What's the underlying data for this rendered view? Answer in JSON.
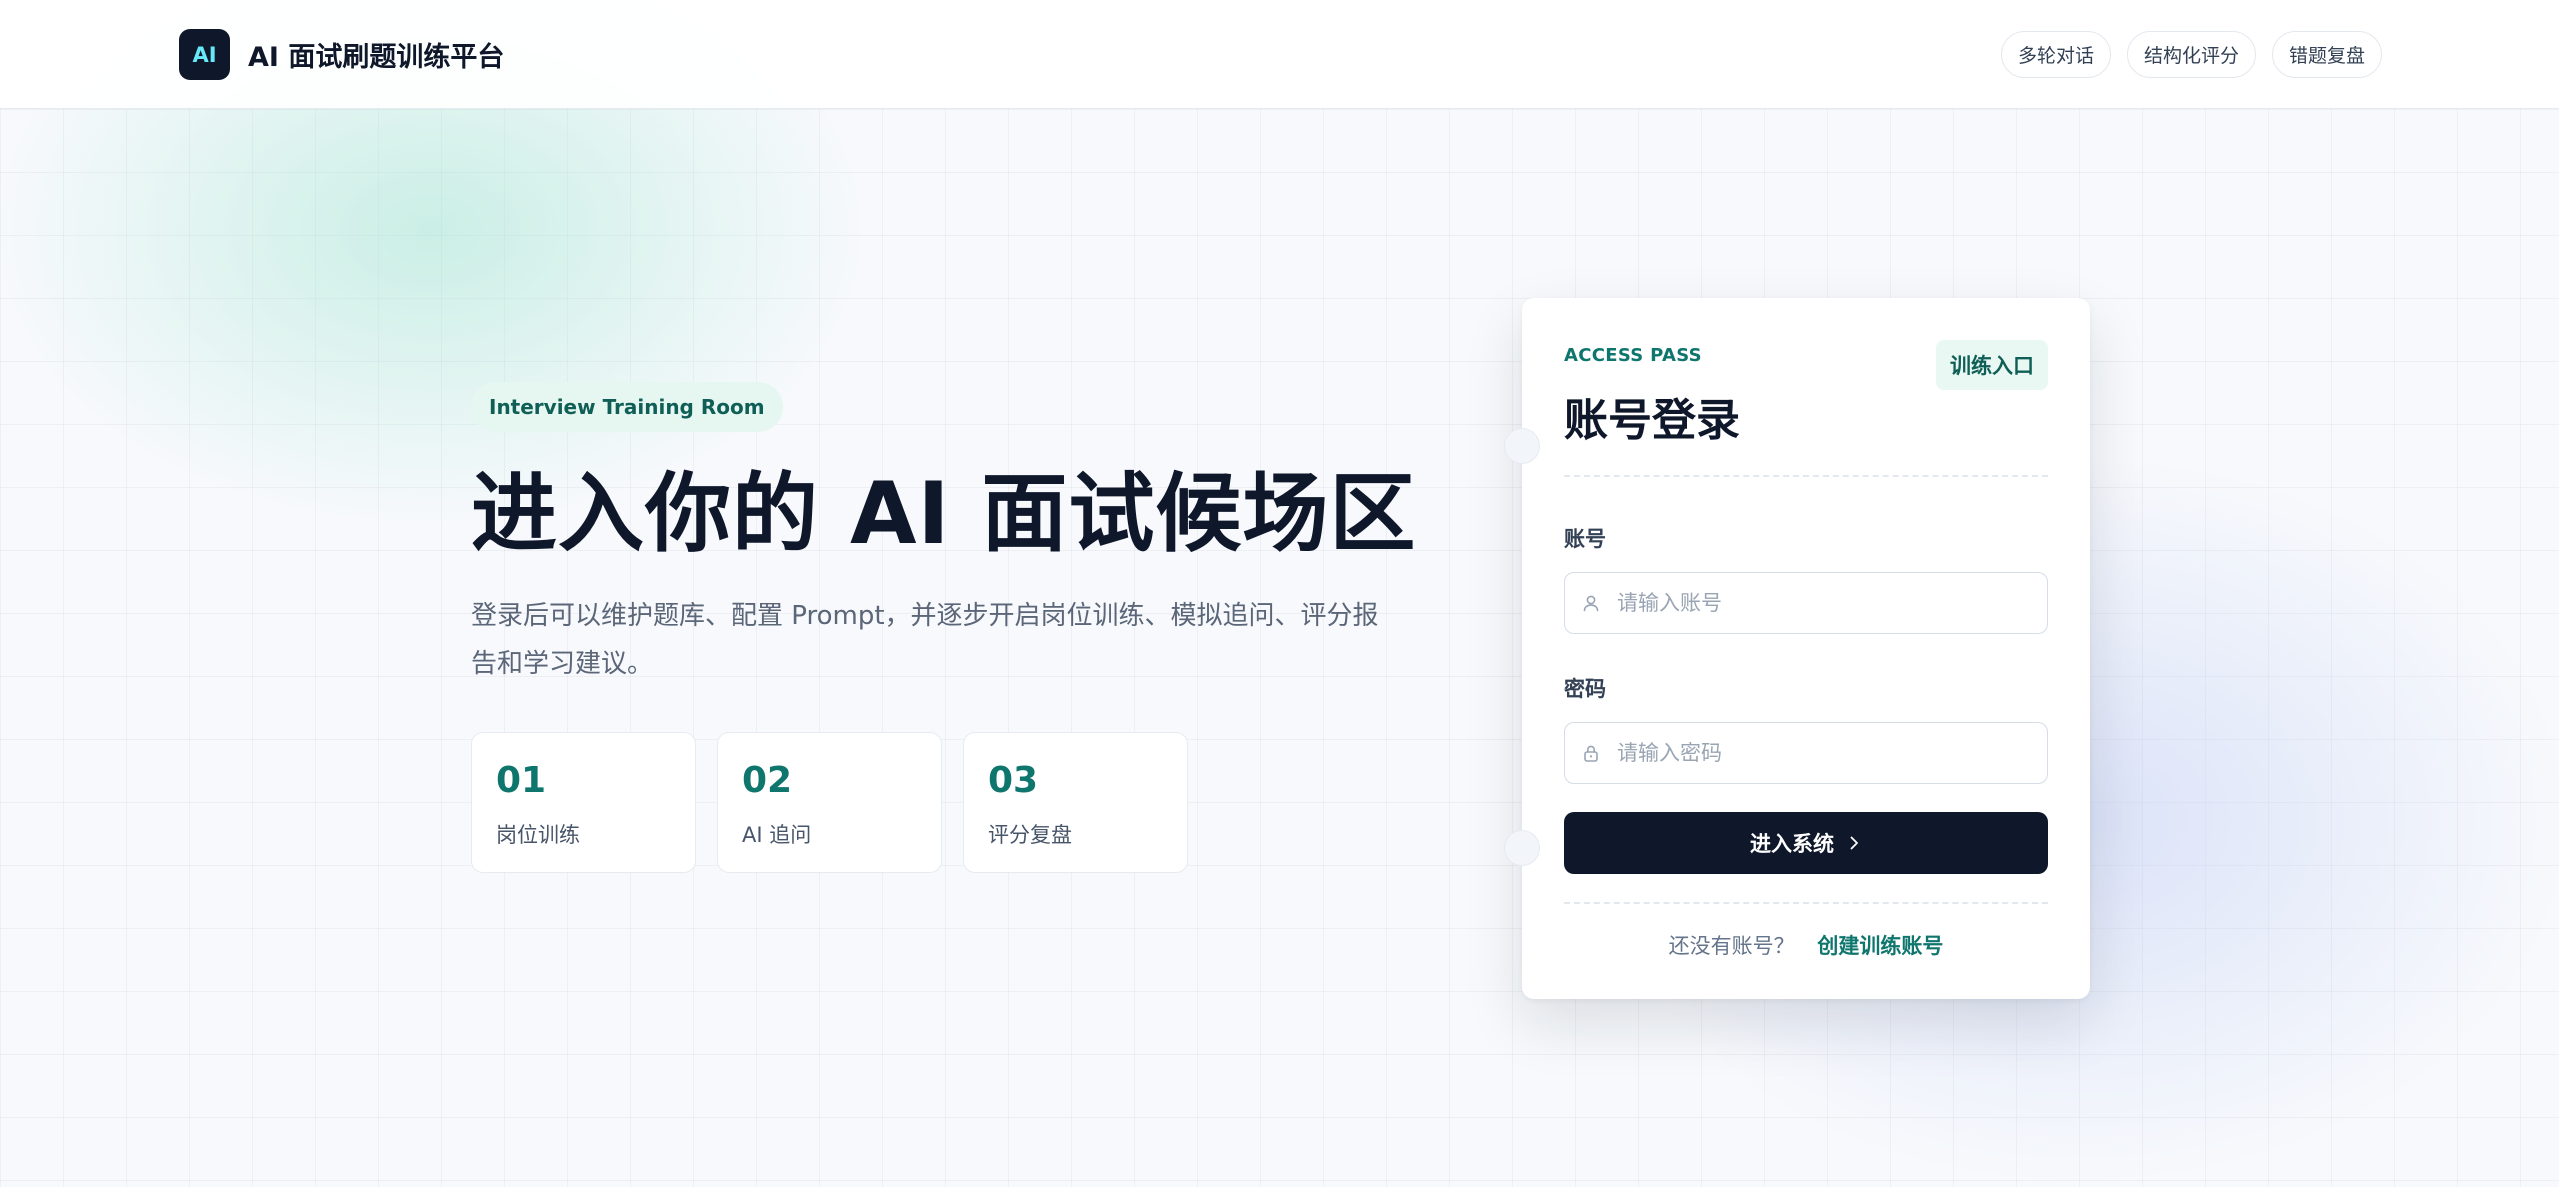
{
  "header": {
    "logo_text": "AI",
    "brand_name": "AI 面试刷题训练平台",
    "nav": [
      "多轮对话",
      "结构化评分",
      "错题复盘"
    ]
  },
  "hero": {
    "badge": "Interview Training Room",
    "title": "进入你的 AI 面试候场区",
    "subtitle": "登录后可以维护题库、配置 Prompt，并逐步开启岗位训练、模拟追问、评分报告和学习建议。",
    "features": [
      {
        "num": "01",
        "label": "岗位训练"
      },
      {
        "num": "02",
        "label": "AI 追问"
      },
      {
        "num": "03",
        "label": "评分复盘"
      }
    ]
  },
  "login": {
    "eyebrow": "ACCESS PASS",
    "title": "账号登录",
    "tag": "训练入口",
    "account_label": "账号",
    "account_placeholder": "请输入账号",
    "password_label": "密码",
    "password_placeholder": "请输入密码",
    "submit": "进入系统",
    "register_question": "还没有账号？",
    "register_link": "创建训练账号"
  },
  "icons": {
    "user": "user-icon",
    "lock": "lock-icon",
    "submit": "chevron-right-icon"
  },
  "colors": {
    "accent": "#0f766e",
    "dark": "#0f172a",
    "badge_bg": "#e6f7f1"
  }
}
